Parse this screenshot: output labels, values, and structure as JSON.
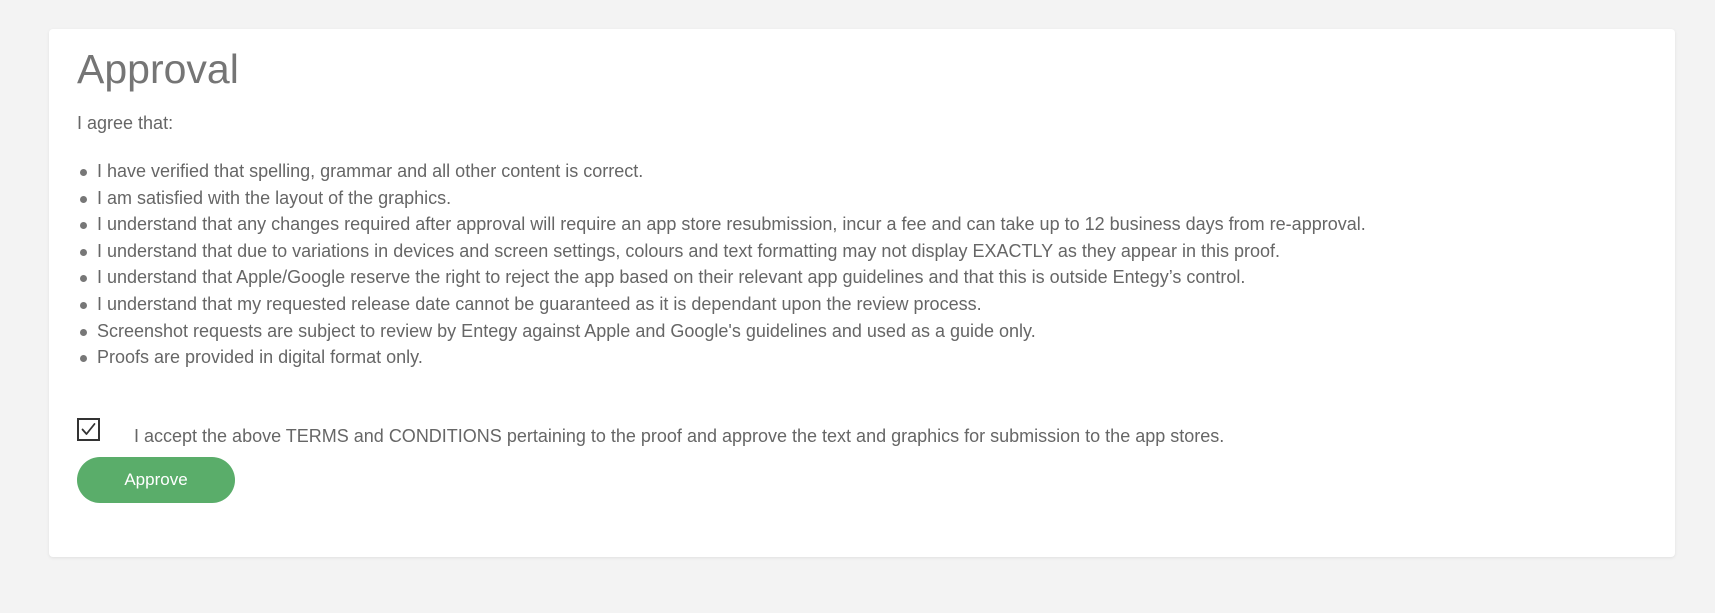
{
  "approval": {
    "title": "Approval",
    "intro": "I agree that:",
    "terms": [
      "I have verified that spelling, grammar and all other content is correct.",
      "I am satisfied with the layout of the graphics.",
      "I understand that any changes required after approval will require an app store resubmission, incur a fee and can take up to 12 business days from re-approval.",
      "I understand that due to variations in devices and screen settings, colours and text formatting may not display EXACTLY as they appear in this proof.",
      "I understand that Apple/Google reserve the right to reject the app based on their relevant app guidelines and that this is outside Entegy’s control.",
      "I understand that my requested release date cannot be guaranteed as it is dependant upon the review process.",
      "Screenshot requests are subject to review by Entegy against Apple and Google's guidelines and used as a guide only.",
      "Proofs are provided in digital format only."
    ],
    "accept_checked": true,
    "accept_label": "I accept the above TERMS and CONDITIONS pertaining to the proof and approve the text and graphics for submission to the app stores.",
    "approve_label": "Approve"
  },
  "colors": {
    "background": "#f3f3f3",
    "card": "#ffffff",
    "text": "#666666",
    "title": "#757575",
    "button": "#5aad6a"
  },
  "icons": {
    "bullet": "bullet-dot-icon",
    "check": "checkmark-icon"
  }
}
